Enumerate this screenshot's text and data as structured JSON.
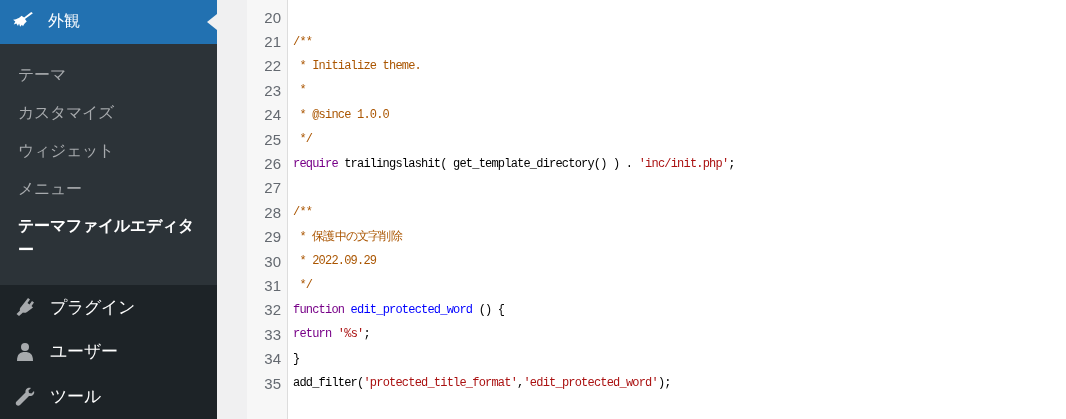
{
  "sidebar": {
    "current": {
      "label": "外観",
      "selected": true
    },
    "submenu": [
      {
        "label": "テーマ",
        "selected": false
      },
      {
        "label": "カスタマイズ",
        "selected": false
      },
      {
        "label": "ウィジェット",
        "selected": false
      },
      {
        "label": "メニュー",
        "selected": false
      },
      {
        "label": "テーマファイルエディター",
        "selected": true
      }
    ],
    "items": [
      {
        "label": "プラグイン",
        "selected": false
      },
      {
        "label": "ユーザー",
        "selected": false
      },
      {
        "label": "ツール",
        "selected": false
      }
    ]
  },
  "editor": {
    "lines": [
      {
        "number": "20"
      },
      {
        "number": "21",
        "tokens": [
          {
            "kind": "comment",
            "text": "/**"
          }
        ]
      },
      {
        "number": "22",
        "tokens": [
          {
            "kind": "comment",
            "text": " * Initialize theme."
          }
        ]
      },
      {
        "number": "23",
        "tokens": [
          {
            "kind": "comment",
            "text": " *"
          }
        ]
      },
      {
        "number": "24",
        "tokens": [
          {
            "kind": "comment",
            "text": " * @since 1.0.0"
          }
        ]
      },
      {
        "number": "25",
        "tokens": [
          {
            "kind": "comment",
            "text": " */"
          }
        ]
      },
      {
        "number": "26",
        "tokens": [
          {
            "kind": "keyword",
            "text": "require"
          },
          {
            "kind": "plain",
            "text": " trailingslashit( get_template_directory() ) . "
          },
          {
            "kind": "string",
            "text": "'inc/init.php'"
          },
          {
            "kind": "plain",
            "text": ";"
          }
        ]
      },
      {
        "number": "27"
      },
      {
        "number": "28",
        "tokens": [
          {
            "kind": "comment",
            "text": "/**"
          }
        ]
      },
      {
        "number": "29",
        "tokens": [
          {
            "kind": "comment",
            "text": " * 保護中の文字削除"
          }
        ]
      },
      {
        "number": "30",
        "tokens": [
          {
            "kind": "comment",
            "text": " * 2022.09.29"
          }
        ]
      },
      {
        "number": "31",
        "tokens": [
          {
            "kind": "comment",
            "text": " */"
          }
        ]
      },
      {
        "number": "32",
        "tokens": [
          {
            "kind": "keyword",
            "text": "function"
          },
          {
            "kind": "def",
            "text": " edit_protected_word"
          },
          {
            "kind": "plain",
            "text": " () {"
          }
        ]
      },
      {
        "number": "33",
        "tokens": [
          {
            "kind": "keyword",
            "text": "return"
          },
          {
            "kind": "string",
            "text": " '%s'"
          },
          {
            "kind": "plain",
            "text": ";"
          }
        ]
      },
      {
        "number": "34",
        "tokens": [
          {
            "kind": "plain",
            "text": "}"
          }
        ]
      },
      {
        "number": "35",
        "tokens": [
          {
            "kind": "plain",
            "text": "add_filter("
          },
          {
            "kind": "string",
            "text": "'protected_title_format'"
          },
          {
            "kind": "plain",
            "text": ","
          },
          {
            "kind": "string",
            "text": "'edit_protected_word'"
          },
          {
            "kind": "plain",
            "text": ");"
          }
        ]
      }
    ]
  }
}
